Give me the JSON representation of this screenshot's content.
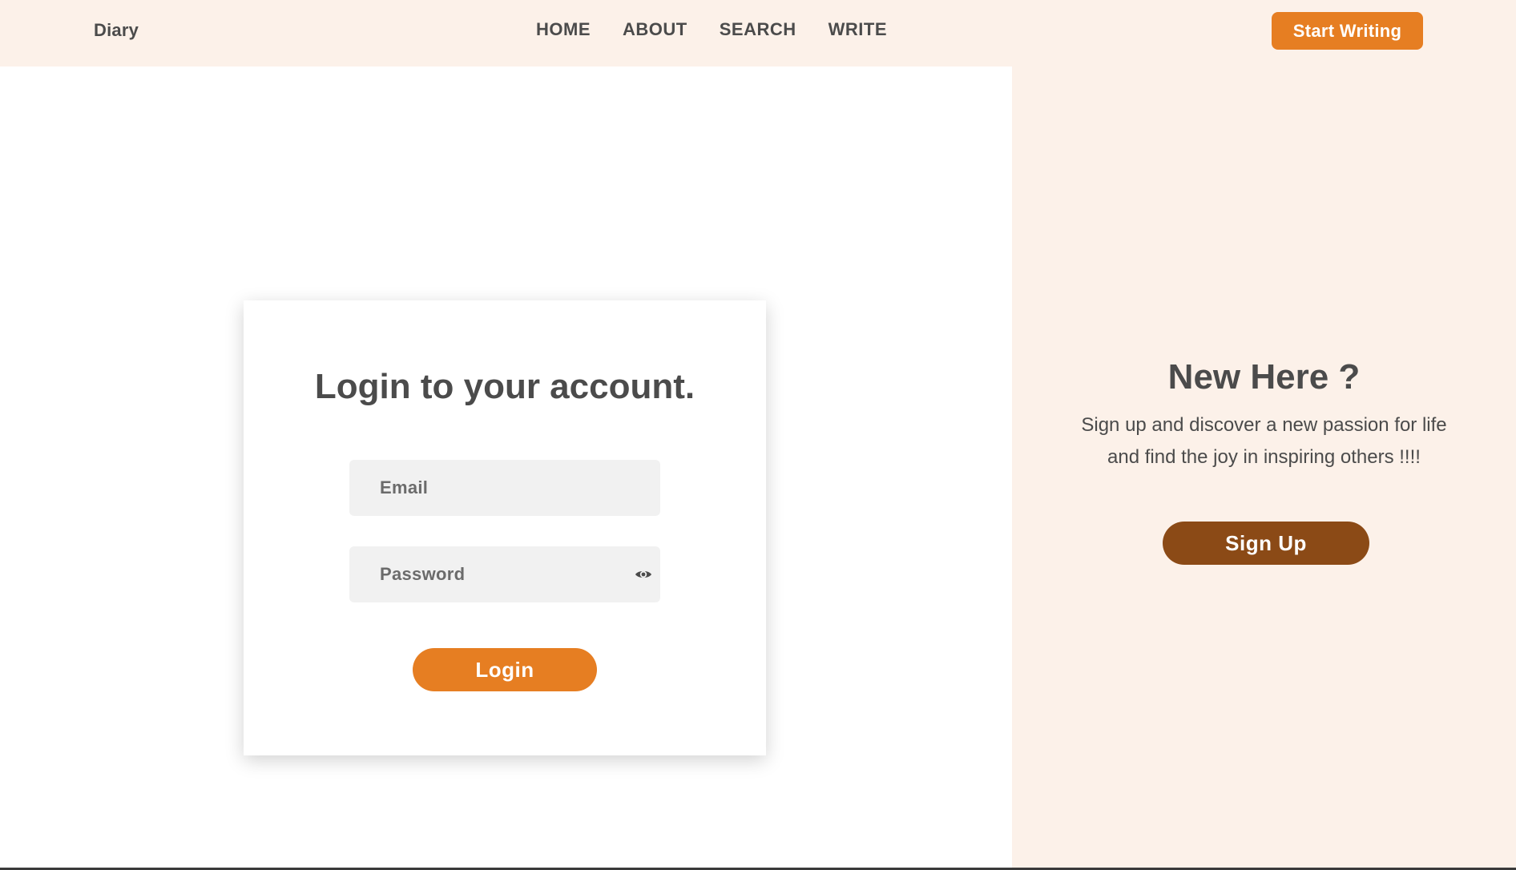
{
  "header": {
    "brand": "Diary",
    "nav": [
      {
        "label": "HOME"
      },
      {
        "label": "ABOUT"
      },
      {
        "label": "SEARCH"
      },
      {
        "label": "WRITE"
      }
    ],
    "cta_label": "Start Writing"
  },
  "login": {
    "title": "Login to your account.",
    "email_placeholder": "Email",
    "password_placeholder": "Password",
    "submit_label": "Login"
  },
  "promo": {
    "title": "New Here ?",
    "text": "Sign up and discover a new passion for life and find the joy in inspiring others !!!!",
    "button_label": "Sign Up"
  },
  "colors": {
    "accent": "#e67e22",
    "secondary": "#8b4a16",
    "panel_background": "#fcf1e9",
    "input_background": "#f1f1f1",
    "text": "#4b4b4b"
  },
  "icons": {
    "password_toggle": "eye-icon"
  }
}
